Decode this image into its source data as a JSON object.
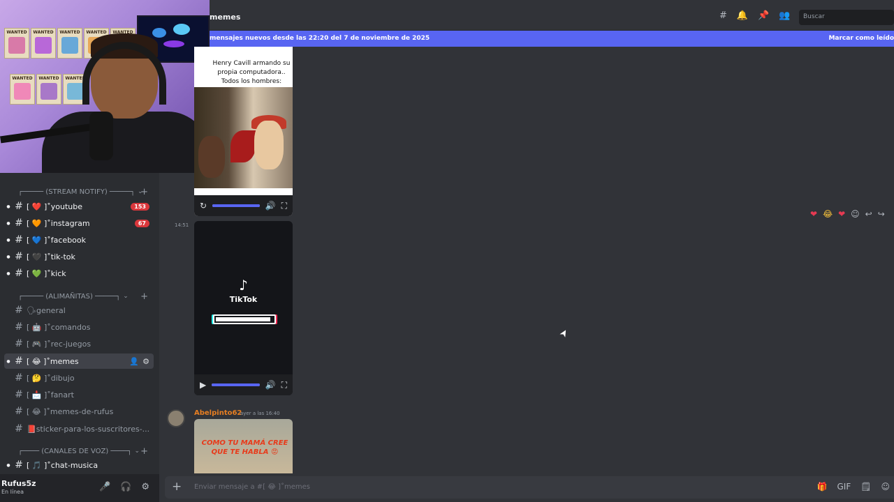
{
  "sidebar": {
    "categories": [
      {
        "label": "┌───── (STREAM NOTIFY) ─────┐",
        "caret": "⌄",
        "plus": "+"
      },
      {
        "label": "┌───── (ALIMAÑITAS) ─────┐",
        "caret": "⌄",
        "plus": "+"
      },
      {
        "label": "┌──── (CANALES DE VOZ) ────┐",
        "caret": "⌄",
        "plus": "+"
      }
    ],
    "channels": [
      {
        "label": "[ ❤️ ]˚youtube",
        "badge": "153",
        "emoji_color": "#e53a52"
      },
      {
        "label": "[ 🧡 ]˚instagram",
        "badge": "67",
        "emoji_color": "#f57c1f"
      },
      {
        "label": "[ 💙 ]˚facebook",
        "emoji_color": "#3a8fe5"
      },
      {
        "label": "[ 🖤 ]˚tik-tok",
        "emoji_color": "#2a2a2a"
      },
      {
        "label": "[ 💚 ]˚kick",
        "emoji_color": "#3ac45a"
      },
      {
        "label": "🗣general",
        "emoji_color": "#949ba4"
      },
      {
        "label": "[ 🤖 ]˚comandos",
        "emoji_color": "#949ba4"
      },
      {
        "label": "[ 🎮 ]˚rec-juegos",
        "emoji_color": "#949ba4"
      },
      {
        "label": "[ 😂 ]˚memes",
        "emoji_color": "#f6c13b"
      },
      {
        "label": "[ 🤔 ]˚dibujo",
        "emoji_color": "#f6c13b"
      },
      {
        "label": "[ 📩 ]˚fanart",
        "emoji_color": "#e8e8e8"
      },
      {
        "label": "[ 😂 ]˚memes-de-rufus",
        "emoji_color": "#f6c13b"
      },
      {
        "label": "📕sticker-para-los-suscritores-...",
        "emoji_color": "#d83a2a"
      },
      {
        "label": "[ 🎵 ]˚chat-musica",
        "emoji_color": "#3a8fe5"
      }
    ],
    "active_actions": {
      "add_user": "👤",
      "settings": "⚙"
    }
  },
  "user": {
    "name": "Rufus5z",
    "status": "En línea",
    "mic": "🎤",
    "headset": "🎧",
    "settings": "⚙"
  },
  "webcam": {
    "posters": [
      "WANTED",
      "WANTED",
      "WANTED",
      "WANTED",
      "WANTED",
      "WANTED",
      "WANTED",
      "WANTED"
    ]
  },
  "header": {
    "channel": "memes",
    "search_placeholder": "Buscar",
    "icons": {
      "threads": "#",
      "bell": "🔔",
      "pin": "📌",
      "members": "👥"
    }
  },
  "new_messages": {
    "text": "mensajes nuevos desde las 22:20 del 7 de noviembre de 2025",
    "mark_read": "Marcar como leído"
  },
  "messages": {
    "meme1_caption": "Henry Cavill armando su propia computadora.. Todos los hombres:",
    "video_controls": {
      "replay": "↻",
      "play": "▶",
      "volume": "🔊",
      "fullscreen": "⛶"
    },
    "timestamp": "14:51",
    "tiktok": {
      "logo": "♪",
      "name": "TikTok",
      "load_fraction": 0.95
    },
    "author": "Abelpinto62",
    "author_time": "ayer a las 16:40",
    "meme3_text": "COMO TU MAMÁ CREE QUE TE HABLA 😡",
    "reactions": [
      "❤",
      "😂",
      "❤"
    ],
    "actions": [
      "☺",
      "↩",
      "↪"
    ]
  },
  "composer": {
    "plus": "+",
    "placeholder": "Enviar mensaje a #[ 😂 ]˚memes",
    "icons": [
      "🎁",
      "GIF",
      "🗒",
      "☺"
    ]
  },
  "colors": {
    "accent": "#5865f2",
    "badge": "#da373c",
    "author": "#e67e22"
  }
}
